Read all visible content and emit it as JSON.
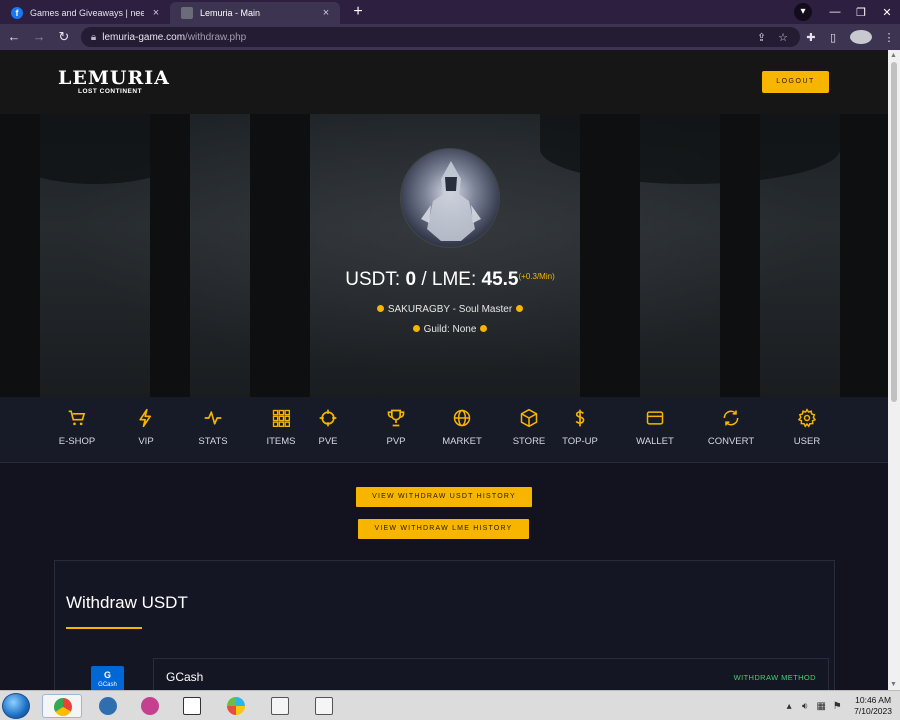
{
  "browser": {
    "tabs": [
      {
        "title": "Games and Giveaways | need p",
        "close": "×"
      },
      {
        "title": "Lemuria - Main",
        "close": "×"
      }
    ],
    "new_tab": "+",
    "url_host": "lemuria-game.com",
    "url_path": "/withdraw.php"
  },
  "header": {
    "logo_title": "LEMURIA",
    "logo_subtitle": "LOST CONTINENT",
    "logout_label": "LOGOUT"
  },
  "profile": {
    "usdt_label": "USDT:",
    "usdt_value": "0",
    "separator": "/",
    "lme_label": "LME:",
    "lme_value": "45.5",
    "lme_rate": "(+0.3/Min)",
    "character": "SAKURAGBY - Soul Master",
    "guild": "Guild: None"
  },
  "nav": {
    "items": [
      {
        "label": "E-SHOP",
        "icon": "cart-icon"
      },
      {
        "label": "VIP",
        "icon": "bolt-icon"
      },
      {
        "label": "STATS",
        "icon": "pulse-icon"
      },
      {
        "label": "ITEMS",
        "icon": "grid-icon"
      },
      {
        "label": "PVE",
        "icon": "crosshair-icon"
      },
      {
        "label": "PVP",
        "icon": "trophy-icon"
      },
      {
        "label": "MARKET",
        "icon": "globe-icon"
      },
      {
        "label": "STORE",
        "icon": "box-icon"
      },
      {
        "label": "TOP-UP",
        "icon": "dollar-icon"
      },
      {
        "label": "WALLET",
        "icon": "card-icon"
      },
      {
        "label": "CONVERT",
        "icon": "refresh-icon"
      },
      {
        "label": "USER",
        "icon": "gear-icon"
      }
    ]
  },
  "actions": {
    "usdt_history": "VIEW WITHDRAW USDT HISTORY",
    "lme_history": "VIEW WITHDRAW LME HISTORY"
  },
  "withdraw": {
    "title": "Withdraw USDT",
    "method_name": "GCash",
    "method_tag": "WITHDRAW METHOD",
    "logo_text_top": "G",
    "logo_text_bottom": "GCash"
  },
  "taskbar": {
    "time": "10:46 AM",
    "date": "7/10/2023"
  },
  "colors": {
    "accent": "#f7b500",
    "method_tag": "#3ed36a",
    "nav_bg": "#171a27",
    "page_bg": "#12131e"
  }
}
